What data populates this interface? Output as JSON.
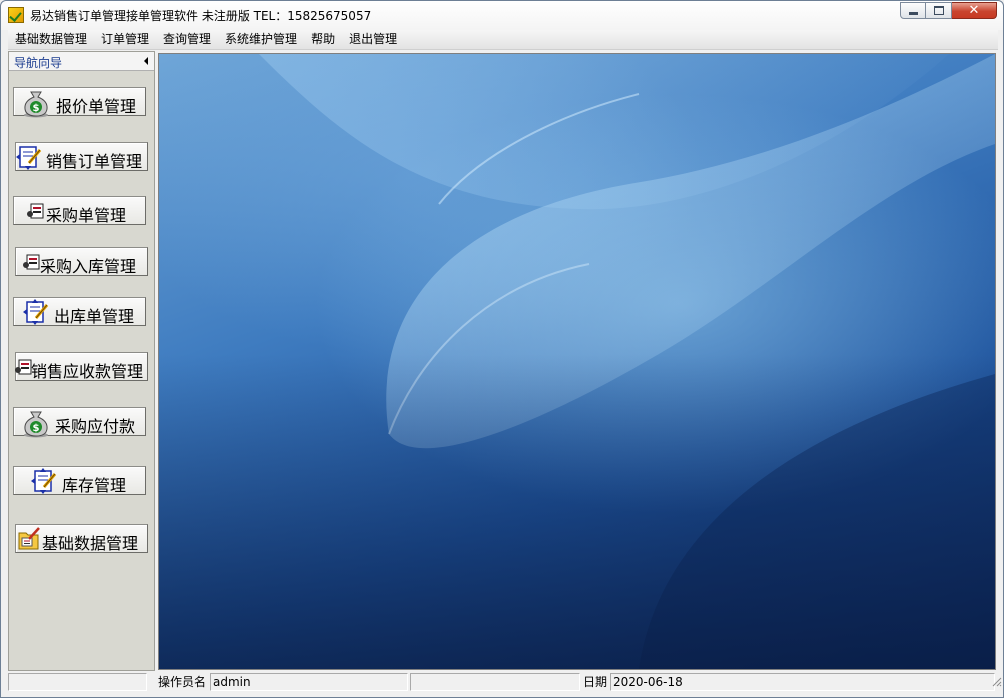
{
  "window": {
    "title": "易达销售订单管理接单管理软件 未注册版  TEL：15825675057",
    "icons": {
      "app": "app-icon",
      "minimize": "minimize-icon",
      "maximize": "maximize-icon",
      "close": "close-icon"
    }
  },
  "menu": [
    {
      "label": "基础数据管理"
    },
    {
      "label": "订单管理"
    },
    {
      "label": "查询管理"
    },
    {
      "label": "系统维护管理"
    },
    {
      "label": "帮助"
    },
    {
      "label": "退出管理"
    }
  ],
  "sidebar": {
    "title": "导航向导",
    "collapse_icon": "collapse-arrow-icon",
    "buttons": [
      {
        "label": "报价单管理",
        "icon": "money-bag-icon"
      },
      {
        "label": "销售订单管理",
        "icon": "document-pencil-icon"
      },
      {
        "label": "采购单管理",
        "icon": "form-icon"
      },
      {
        "label": "采购入库管理",
        "icon": "form-icon"
      },
      {
        "label": "出库单管理",
        "icon": "document-pencil-icon"
      },
      {
        "label": "销售应收款管理",
        "icon": "form-icon"
      },
      {
        "label": "采购应付款",
        "icon": "money-bag-icon"
      },
      {
        "label": "库存管理",
        "icon": "document-pencil-icon"
      },
      {
        "label": "基础数据管理",
        "icon": "folder-pencil-icon"
      }
    ]
  },
  "statusbar": {
    "operator_label": "操作员名",
    "operator_value": "admin",
    "date_label": "日期",
    "date_value": "2020-06-18"
  },
  "colors": {
    "nav_title": "#1b3c8f",
    "sidebar_bg": "#d8d8d0",
    "desktop_dark": "#0f2d64",
    "desktop_light": "#6fa6d8"
  }
}
